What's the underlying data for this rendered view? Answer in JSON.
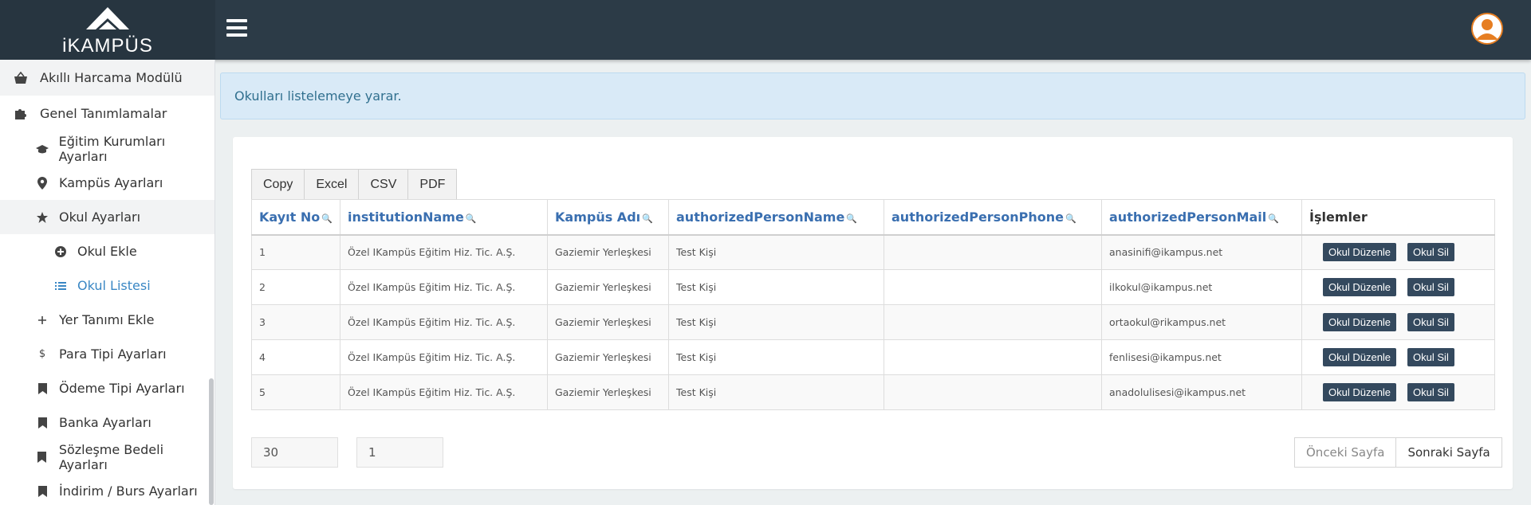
{
  "brand": {
    "name": "iKAMPÜS"
  },
  "sidebar": {
    "items": [
      {
        "label": "Akıllı Harcama Modülü",
        "icon": "basket-icon"
      },
      {
        "label": "Genel Tanımlamalar",
        "icon": "puzzle-icon"
      },
      {
        "label": "Eğitim Kurumları Ayarları",
        "icon": "graduation-cap-icon"
      },
      {
        "label": "Kampüs Ayarları",
        "icon": "map-pin-icon"
      },
      {
        "label": "Okul Ayarları",
        "icon": "star-icon"
      },
      {
        "label": "Okul Ekle",
        "icon": "plus-circle-icon"
      },
      {
        "label": "Okul Listesi",
        "icon": "list-icon"
      },
      {
        "label": "Yer Tanımı Ekle",
        "icon": "plus-icon"
      },
      {
        "label": "Para Tipi Ayarları",
        "icon": "dollar-icon"
      },
      {
        "label": "Ödeme Tipi Ayarları",
        "icon": "bookmark-icon"
      },
      {
        "label": "Banka Ayarları",
        "icon": "bookmark-icon"
      },
      {
        "label": "Sözleşme Bedeli Ayarları",
        "icon": "bookmark-icon"
      },
      {
        "label": "İndirim / Burs Ayarları",
        "icon": "bookmark-icon"
      }
    ]
  },
  "info": {
    "text": "Okulları listelemeye yarar."
  },
  "export_buttons": [
    "Copy",
    "Excel",
    "CSV",
    "PDF"
  ],
  "table": {
    "headers": [
      "Kayıt No",
      "institutionName",
      "Kampüs Adı",
      "authorizedPersonName",
      "authorizedPersonPhone",
      "authorizedPersonMail",
      "İşlemler"
    ],
    "rows": [
      {
        "id": "1",
        "institution": "Özel IKampüs Eğitim Hiz. Tic. A.Ş.",
        "campus": "Gaziemir Yerleşkesi",
        "person": "Test Kişi",
        "phone": "",
        "mail": "anasinifi@ikampus.net"
      },
      {
        "id": "2",
        "institution": "Özel IKampüs Eğitim Hiz. Tic. A.Ş.",
        "campus": "Gaziemir Yerleşkesi",
        "person": "Test Kişi",
        "phone": "",
        "mail": "ilkokul@ikampus.net"
      },
      {
        "id": "3",
        "institution": "Özel IKampüs Eğitim Hiz. Tic. A.Ş.",
        "campus": "Gaziemir Yerleşkesi",
        "person": "Test Kişi",
        "phone": "",
        "mail": "ortaokul@rikampus.net"
      },
      {
        "id": "4",
        "institution": "Özel IKampüs Eğitim Hiz. Tic. A.Ş.",
        "campus": "Gaziemir Yerleşkesi",
        "person": "Test Kişi",
        "phone": "",
        "mail": "fenlisesi@ikampus.net"
      },
      {
        "id": "5",
        "institution": "Özel IKampüs Eğitim Hiz. Tic. A.Ş.",
        "campus": "Gaziemir Yerleşkesi",
        "person": "Test Kişi",
        "phone": "",
        "mail": "anadolulisesi@ikampus.net"
      }
    ],
    "edit_label": "Okul Düzenle",
    "delete_label": "Okul Sil"
  },
  "pagination": {
    "page_size": "30",
    "page_number": "1",
    "prev_label": "Önceki Sayfa",
    "next_label": "Sonraki Sayfa"
  },
  "colors": {
    "topbar": "#2c3b47",
    "accent": "#3a87c4",
    "button_dark": "#34495e",
    "avatar": "#e67e22"
  }
}
